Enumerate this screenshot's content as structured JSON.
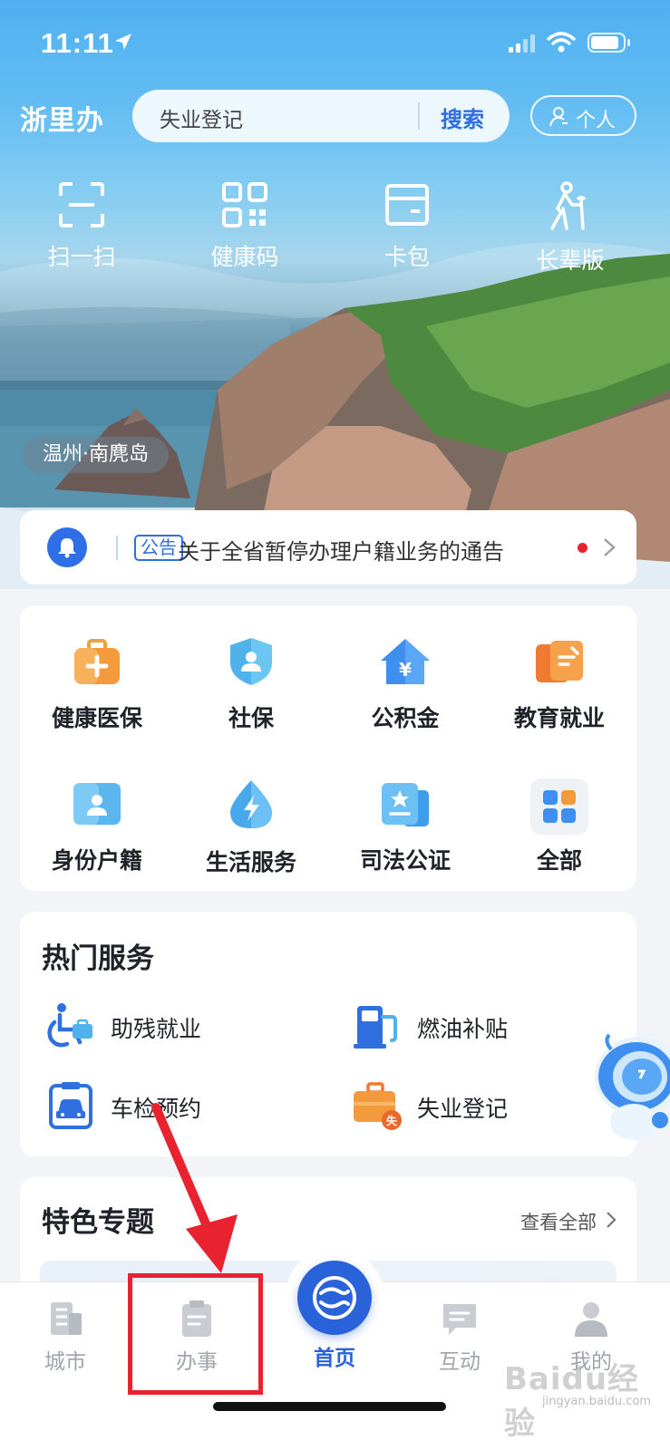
{
  "status_bar": {
    "time": "11:11"
  },
  "header": {
    "logo": "浙里办",
    "search_value": "失业登记",
    "search_button": "搜索",
    "profile_button": "个人"
  },
  "quick_actions": [
    {
      "label": "扫一扫",
      "icon": "scan-icon"
    },
    {
      "label": "健康码",
      "icon": "qr-code-icon"
    },
    {
      "label": "卡包",
      "icon": "card-wallet-icon"
    },
    {
      "label": "长辈版",
      "icon": "elder-icon"
    }
  ],
  "location_tag": "温州·南麂岛",
  "notice": {
    "tag": "公告",
    "text": "关于全省暂停办理户籍业务的通告"
  },
  "services": [
    {
      "label": "健康医保",
      "icon": "medical-kit-icon"
    },
    {
      "label": "社保",
      "icon": "shield-person-icon"
    },
    {
      "label": "公积金",
      "icon": "house-fund-icon"
    },
    {
      "label": "教育就业",
      "icon": "education-icon"
    },
    {
      "label": "身份户籍",
      "icon": "id-card-icon"
    },
    {
      "label": "生活服务",
      "icon": "lightning-drop-icon"
    },
    {
      "label": "司法公证",
      "icon": "justice-icon"
    },
    {
      "label": "全部",
      "icon": "grid-all-icon"
    }
  ],
  "hot_services": {
    "title": "热门服务",
    "items": [
      {
        "label": "助残就业",
        "icon": "wheelchair-icon"
      },
      {
        "label": "燃油补贴",
        "icon": "fuel-pump-icon"
      },
      {
        "label": "车检预约",
        "icon": "car-inspection-icon"
      },
      {
        "label": "失业登记",
        "icon": "unemployment-briefcase-icon"
      }
    ]
  },
  "featured": {
    "title": "特色专题",
    "more": "查看全部"
  },
  "tabbar": [
    {
      "label": "城市",
      "icon": "city-icon"
    },
    {
      "label": "办事",
      "icon": "clipboard-icon"
    },
    {
      "label": "首页",
      "icon": "home-logo-icon"
    },
    {
      "label": "互动",
      "icon": "chat-icon"
    },
    {
      "label": "我的",
      "icon": "person-icon"
    }
  ],
  "colors": {
    "accent": "#2a62d9",
    "annotation": "#e8232f",
    "notice_dot": "#e8232f"
  },
  "watermark": {
    "main": "Baidu经验",
    "sub": "jingyan.baidu.com"
  }
}
